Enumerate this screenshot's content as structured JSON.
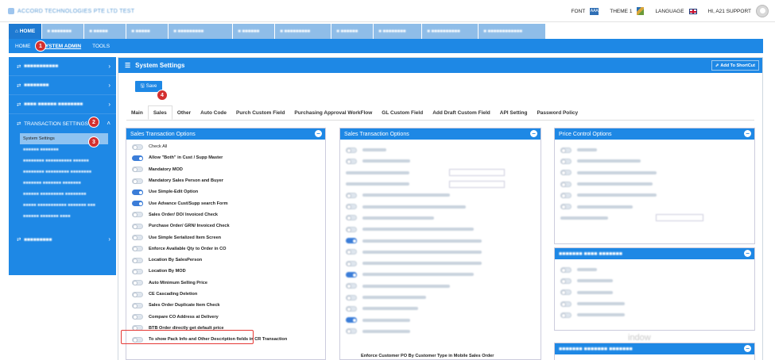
{
  "header": {
    "logo_text": "ACCORD TECHNOLOGIES PTE LTD TEST",
    "font_label": "FONT",
    "font_icon_text": "AAA",
    "theme_label": "THEME 1",
    "language_label": "LANGUAGE",
    "user_label": "HI, A21 SUPPORT"
  },
  "module_tabs": [
    {
      "label": "HOME",
      "active": true
    },
    {
      "label": "■ ■■■■■■■"
    },
    {
      "label": "■ ■■■■■"
    },
    {
      "label": "■ ■■■■■"
    },
    {
      "label": "■ ■■■■■■■■■"
    },
    {
      "label": "■ ■■■■■■"
    },
    {
      "label": "■ ■■■■■■■■■"
    },
    {
      "label": "■ ■■■■■■"
    },
    {
      "label": "■ ■■■■■■■■"
    },
    {
      "label": "■ ■■■■■■■■■■"
    },
    {
      "label": "■ ■■■■■■■■■■■■"
    }
  ],
  "subnav": {
    "home": "HOME",
    "system_admin": "SYSTEM ADMIN",
    "tools": "TOOLS"
  },
  "sidebar": {
    "top_items": [
      "■■■■■■■■■■■",
      "■■■■■■■■",
      "■■■■ ■■■■■■ ■■■■■■■■"
    ],
    "transaction_settings": "TRANSACTION SETTINGS",
    "sub_active": "System Settings",
    "sub_items": [
      "■■■■■■ ■■■■■■■",
      "■■■■■■■■ ■■■■■■■■■■ ■■■■■■",
      "■■■■■■■■ ■■■■■■■■■ ■■■■■■■■",
      "■■■■■■■ ■■■■■■■ ■■■■■■■",
      "■■■■■■ ■■■■■■■■■ ■■■■■■■■",
      "■■■■■ ■■■■■■■■■■■ ■■■■■■■ ■■■",
      "■■■■■■ ■■■■■■■ ■■■■"
    ],
    "reporting": "■■■■■■■■■"
  },
  "badges": [
    "1",
    "2",
    "3",
    "4"
  ],
  "content": {
    "title": "System Settings",
    "shortcut": "Add To ShortCut",
    "save": "Save",
    "tabs": [
      "Main",
      "Sales",
      "Other",
      "Auto Code",
      "Purch Custom Field",
      "Purchasing Approval WorkFlow",
      "GL Custom Field",
      "Add Draft Custom Field",
      "API Setting",
      "Password Policy"
    ]
  },
  "panel1": {
    "title": "Sales Transaction Options",
    "options": [
      {
        "label": "Check All",
        "on": false,
        "bold": false
      },
      {
        "label": "Allow \"Both\" in Cust / Supp Master",
        "on": true
      },
      {
        "label": "Mandatory MOD",
        "on": false
      },
      {
        "label": "Mandatory Sales Person and Buyer",
        "on": false
      },
      {
        "label": "Use Simple-Edit Option",
        "on": true
      },
      {
        "label": "Use Advance Cust/Supp search Form",
        "on": true
      },
      {
        "label": "Sales Order/ DO/ Invoiced Check",
        "on": false
      },
      {
        "label": "Purchase Order/ GRN/ Invoiced Check",
        "on": false
      },
      {
        "label": "Use Simple Serialized Item Screen",
        "on": false
      },
      {
        "label": "Enforce Available Qty to Order in CO",
        "on": false
      },
      {
        "label": "Location By SalesPerson",
        "on": false
      },
      {
        "label": "Location By MOD",
        "on": false
      },
      {
        "label": "Auto Minimum Selling Price",
        "on": false
      },
      {
        "label": "CE Cascading Deletion",
        "on": false
      },
      {
        "label": "Sales Order Duplicate Item Check",
        "on": false
      },
      {
        "label": "Compare CO Address at Delivery",
        "on": false
      },
      {
        "label": "BTB Order directly get default price",
        "on": false
      },
      {
        "label": "To show Pack Info and Other Description fields in CR Transaction",
        "on": false
      }
    ]
  },
  "panel2": {
    "title": "Sales Transaction Options",
    "last_option": "Enforce Customer PO By Customer Type in Mobile Sales Order"
  },
  "panel3": {
    "title": "Price Control Options"
  },
  "panel4": {
    "title": "■■■■■■■ ■■■■ ■■■■■■■"
  },
  "panel5": {
    "title": "■■■■■■■ ■■■■■■■ ■■■■■■■"
  },
  "watermark": "indow"
}
